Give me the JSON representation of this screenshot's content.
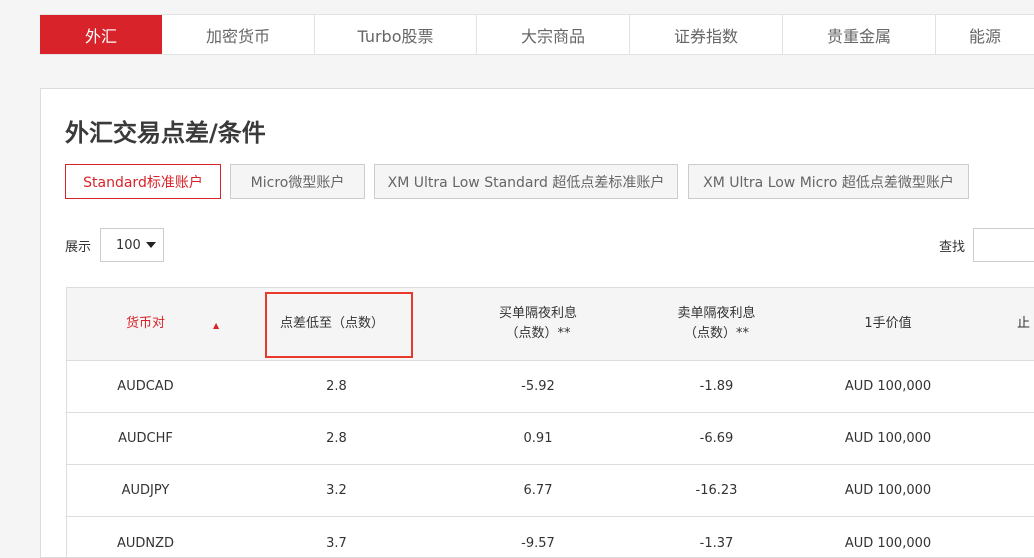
{
  "tabs": [
    {
      "label": "外汇",
      "active": true
    },
    {
      "label": "加密货币"
    },
    {
      "label": "Turbo股票"
    },
    {
      "label": "大宗商品"
    },
    {
      "label": "证券指数"
    },
    {
      "label": "贵重金属"
    },
    {
      "label": "能源"
    }
  ],
  "page": {
    "title": "外汇交易点差/条件"
  },
  "accounts": [
    {
      "label": "Standard标准账户",
      "active": true
    },
    {
      "label": "Micro微型账户"
    },
    {
      "label": "XM Ultra Low Standard 超低点差标准账户"
    },
    {
      "label": "XM Ultra Low Micro 超低点差微型账户"
    }
  ],
  "controls": {
    "show_label": "展示",
    "show_value": "100",
    "search_label": "查找",
    "search_value": ""
  },
  "table": {
    "columns": [
      {
        "line1": "货币对",
        "line2": ""
      },
      {
        "line1": "点差低至（点数）",
        "line2": ""
      },
      {
        "line1": "买单隔夜利息",
        "line2": "（点数）**"
      },
      {
        "line1": "卖单隔夜利息",
        "line2": "（点数）**"
      },
      {
        "line1": "1手价值",
        "line2": ""
      },
      {
        "line1": "止",
        "line2": ""
      }
    ],
    "sort_indicator": "▲",
    "rows": [
      [
        "AUDCAD",
        "2.8",
        "-5.92",
        "-1.89",
        "AUD 100,000"
      ],
      [
        "AUDCHF",
        "2.8",
        "0.91",
        "-6.69",
        "AUD 100,000"
      ],
      [
        "AUDJPY",
        "3.2",
        "6.77",
        "-16.23",
        "AUD 100,000"
      ],
      [
        "AUDNZD",
        "3.7",
        "-9.57",
        "-1.37",
        "AUD 100,000"
      ]
    ]
  },
  "colors": {
    "accent": "#d8232a",
    "highlight": "#e8392d"
  }
}
